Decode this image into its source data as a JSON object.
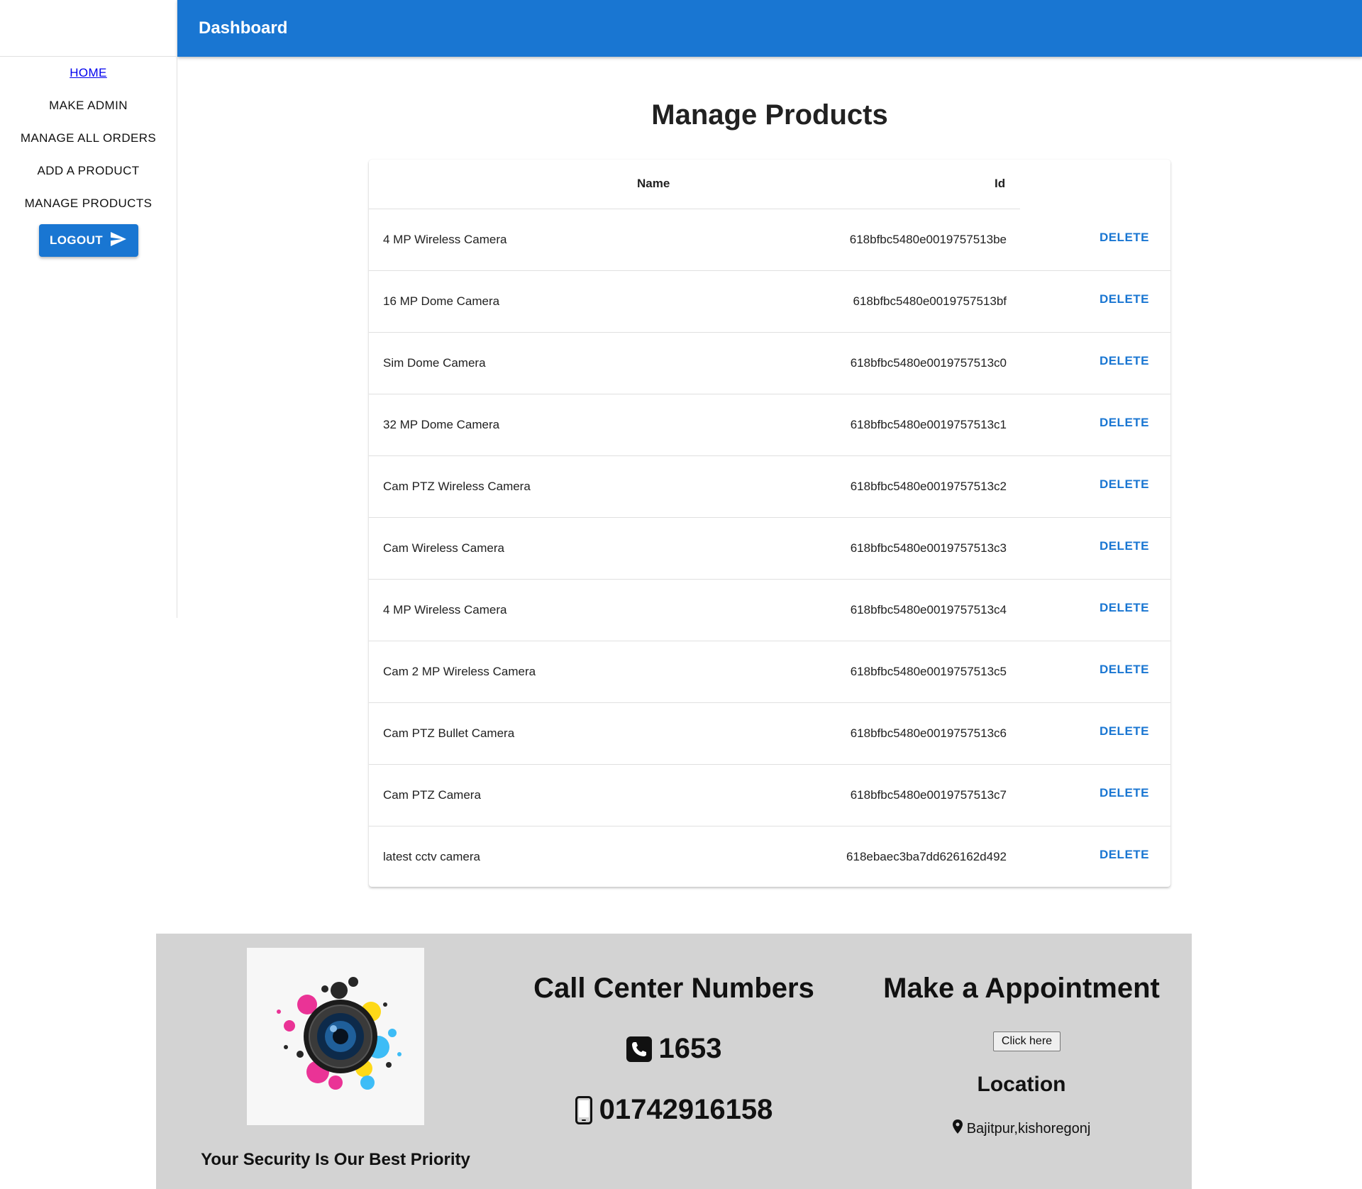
{
  "appbar": {
    "title": "Dashboard"
  },
  "sidebar": {
    "items": [
      {
        "label": "HOME"
      },
      {
        "label": "MAKE ADMIN"
      },
      {
        "label": "MANAGE ALL ORDERS"
      },
      {
        "label": "ADD A PRODUCT"
      },
      {
        "label": "MANAGE PRODUCTS"
      }
    ],
    "logout_label": "LOGOUT"
  },
  "main": {
    "title": "Manage Products",
    "table": {
      "headers": {
        "name": "Name",
        "id": "Id"
      },
      "delete_label": "DELETE",
      "rows": [
        {
          "name": "4 MP Wireless Camera",
          "id": "618bfbc5480e0019757513be"
        },
        {
          "name": "16 MP Dome Camera",
          "id": "618bfbc5480e0019757513bf"
        },
        {
          "name": "Sim Dome Camera",
          "id": "618bfbc5480e0019757513c0"
        },
        {
          "name": "32 MP Dome Camera",
          "id": "618bfbc5480e0019757513c1"
        },
        {
          "name": "Cam PTZ Wireless Camera",
          "id": "618bfbc5480e0019757513c2"
        },
        {
          "name": "Cam Wireless Camera",
          "id": "618bfbc5480e0019757513c3"
        },
        {
          "name": "4 MP Wireless Camera",
          "id": "618bfbc5480e0019757513c4"
        },
        {
          "name": "Cam 2 MP Wireless Camera",
          "id": "618bfbc5480e0019757513c5"
        },
        {
          "name": "Cam PTZ Bullet Camera",
          "id": "618bfbc5480e0019757513c6"
        },
        {
          "name": "Cam PTZ Camera",
          "id": "618bfbc5480e0019757513c7"
        },
        {
          "name": "latest cctv camera",
          "id": "618ebaec3ba7dd626162d492"
        }
      ]
    }
  },
  "footer": {
    "tagline": "Your Security Is Our Best Priority",
    "call_center": {
      "title": "Call Center Numbers",
      "phone_number": "1653",
      "mobile_number": "01742916158"
    },
    "appointment": {
      "title": "Make a Appointment",
      "button_label": "Click here"
    },
    "location": {
      "title": "Location",
      "address": "Bajitpur,kishoregonj"
    }
  },
  "icons": {
    "logout": "send-icon",
    "phone": "phone-square-icon",
    "mobile": "mobile-phone-icon",
    "location": "map-marker-icon",
    "logo": "camera-lens-splash-logo"
  },
  "colors": {
    "primary": "#1976d2",
    "footer_bg": "#d3d3d3",
    "link": "#0000ee"
  }
}
